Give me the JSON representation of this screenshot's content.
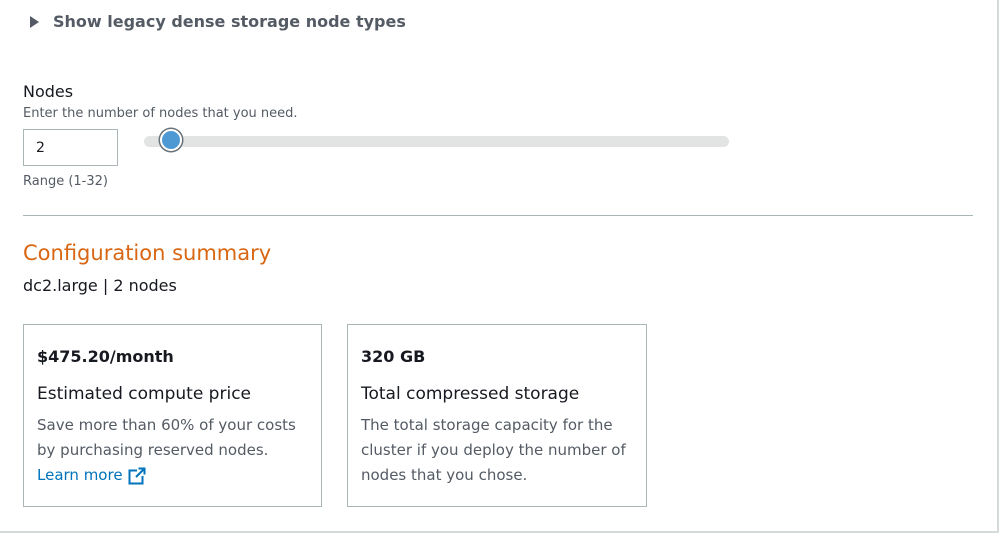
{
  "legacy": {
    "label": "Show legacy dense storage node types",
    "icon": "caret-right-icon"
  },
  "nodes": {
    "label": "Nodes",
    "description": "Enter the number of nodes that you need.",
    "value": "2",
    "range_text": "Range (1-32)",
    "slider_min": 1,
    "slider_max": 32,
    "slider_value": 2
  },
  "summary": {
    "title": "Configuration summary",
    "subtitle": "dc2.large | 2 nodes",
    "price_card": {
      "value": "$475.20/month",
      "heading": "Estimated compute price",
      "body": "Save more than 60% of your costs by purchasing reserved nodes.",
      "link_label": "Learn more",
      "link_icon": "external-link-icon"
    },
    "storage_card": {
      "value": "320 GB",
      "heading": "Total compressed storage",
      "body": "The total storage capacity for the cluster if you deploy the number of nodes that you chose."
    }
  },
  "colors": {
    "accent_orange": "#d86613",
    "link_blue": "#0073bb",
    "slider_thumb": "#4e98d3",
    "border_gray": "#aab7b8"
  }
}
